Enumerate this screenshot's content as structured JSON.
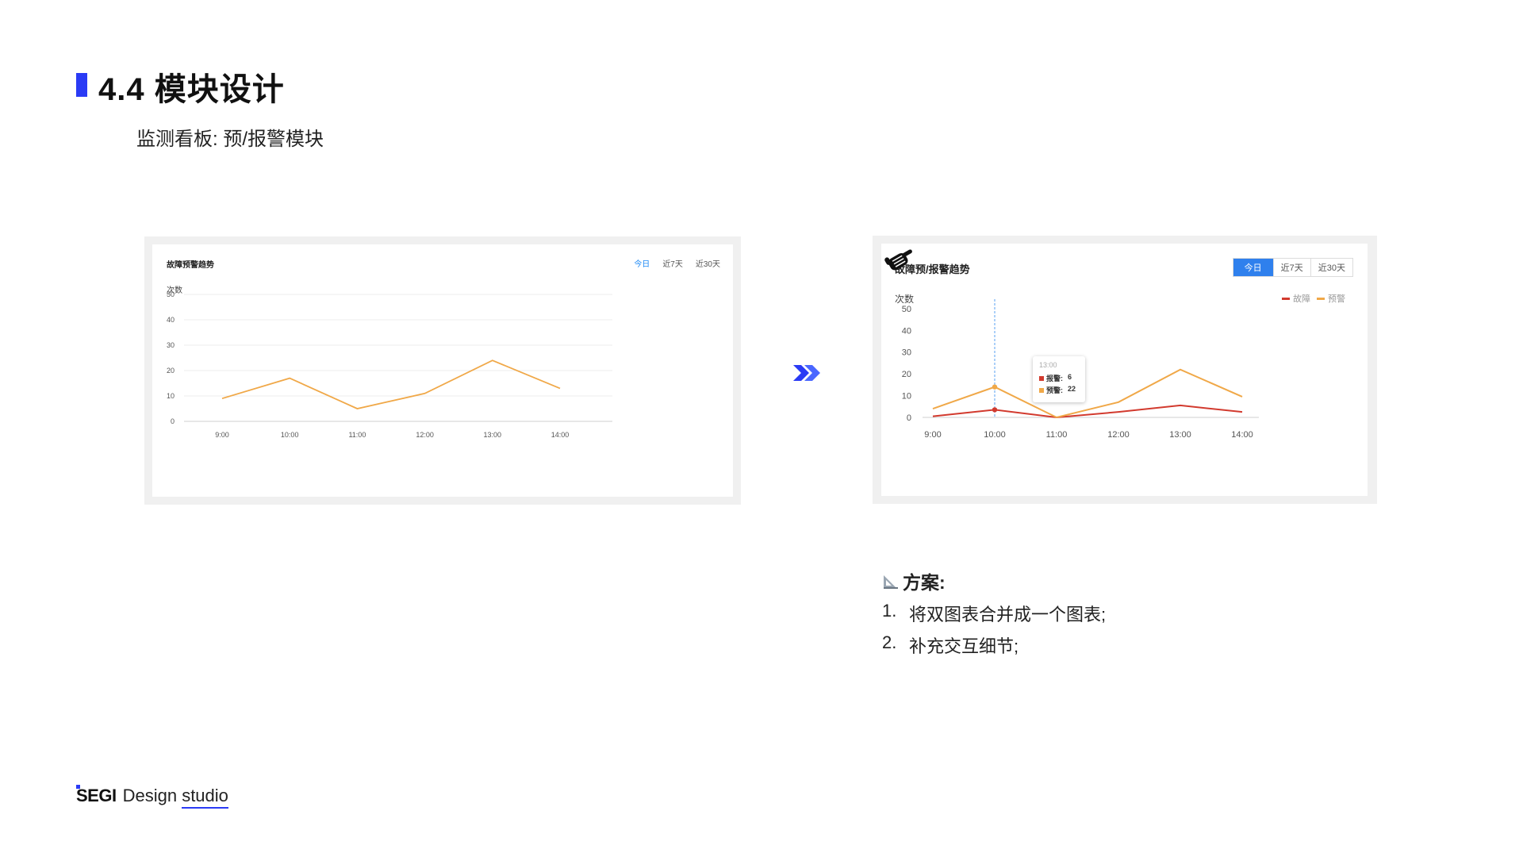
{
  "header": {
    "title": "4.4 模块设计",
    "subtitle": "监测看板: 预/报警模块"
  },
  "chart_before": {
    "title": "故障预警趋势",
    "tabs": [
      "今日",
      "近7天",
      "近30天"
    ],
    "active_tab": "今日",
    "unit": "次数"
  },
  "chart_after": {
    "title": "故障预/报警趋势",
    "tabs": [
      "今日",
      "近7天",
      "近30天"
    ],
    "active_tab": "今日",
    "unit": "次数",
    "legend": [
      "故障",
      "预警"
    ],
    "tooltip": {
      "time": "13:00",
      "rows": [
        {
          "label": "报警:",
          "value": "6",
          "color": "#d23a2e"
        },
        {
          "label": "预警:",
          "value": "22",
          "color": "#f0a848"
        }
      ]
    }
  },
  "chart_data": [
    {
      "type": "line",
      "title": "故障预警趋势",
      "xlabel": "",
      "ylabel": "次数",
      "categories": [
        "9:00",
        "10:00",
        "11:00",
        "12:00",
        "13:00",
        "14:00"
      ],
      "yticks": [
        0,
        10,
        20,
        30,
        40,
        50
      ],
      "ylim": [
        0,
        50
      ],
      "grid": true,
      "series": [
        {
          "values": [
            9,
            17,
            5,
            11,
            24,
            13
          ],
          "color": "#f0a848"
        }
      ]
    },
    {
      "type": "line",
      "title": "故障预/报警趋势",
      "xlabel": "",
      "ylabel": "次数",
      "categories": [
        "9:00",
        "10:00",
        "11:00",
        "12:00",
        "13:00",
        "14:00"
      ],
      "yticks": [
        0,
        10,
        20,
        30,
        40,
        50
      ],
      "ylim": [
        0,
        50
      ],
      "grid": false,
      "legend_position": "top-right",
      "series": [
        {
          "name": "故障",
          "values": [
            0.5,
            3.5,
            0,
            2.5,
            5.5,
            2.5
          ],
          "color": "#d23a2e"
        },
        {
          "name": "预警",
          "values": [
            4,
            14,
            0,
            7,
            22,
            9.5
          ],
          "color": "#f0a848"
        }
      ]
    }
  ],
  "solution": {
    "heading": "方案:",
    "items": [
      {
        "num": "1.",
        "text": "将双图表合并成一个图表;"
      },
      {
        "num": "2.",
        "text": "补充交互细节;"
      }
    ]
  },
  "footer": {
    "brand": "SEGI",
    "studio_prefix": "Design",
    "studio_suffix": "studio"
  },
  "colors": {
    "accent": "#2a3bf5",
    "tab_active_bg": "#2f80ed",
    "series_orange": "#f0a848",
    "series_red": "#d23a2e"
  },
  "icons": {
    "arrow": "double-chevron-right-icon",
    "ruler": "triangle-ruler-icon",
    "hand": "pointing-hand-cursor-icon"
  }
}
